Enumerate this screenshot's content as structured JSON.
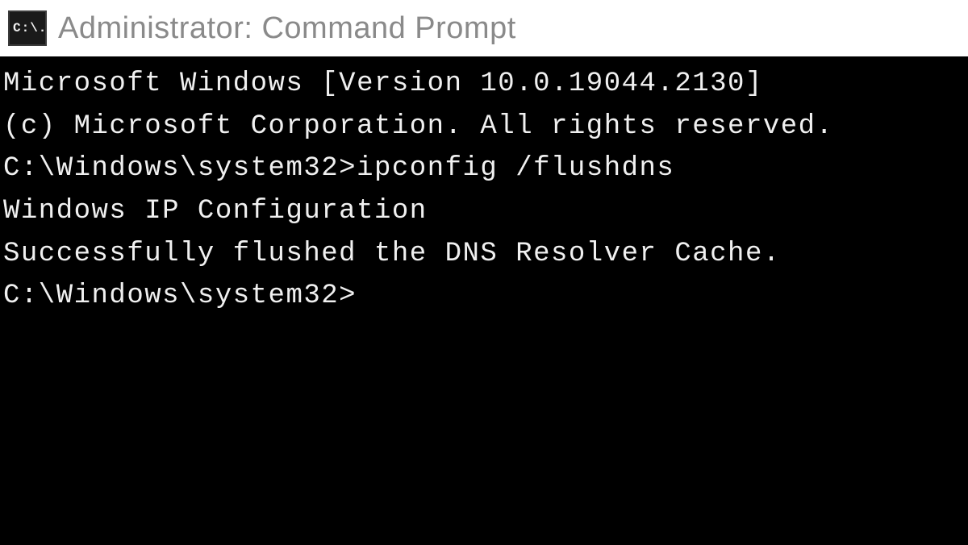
{
  "titlebar": {
    "icon_label": "C:\\.",
    "title": "Administrator: Command Prompt"
  },
  "terminal": {
    "line1": "Microsoft Windows [Version 10.0.19044.2130]",
    "line2": "(c) Microsoft Corporation. All rights reserved.",
    "blank1": "",
    "prompt1": "C:\\Windows\\system32>",
    "command1": "ipconfig /flushdns",
    "blank2": "",
    "output_header": "Windows IP Configuration",
    "blank3": "",
    "output_msg": "Successfully flushed the DNS Resolver Cache.",
    "blank4": "",
    "prompt2": "C:\\Windows\\system32>"
  }
}
